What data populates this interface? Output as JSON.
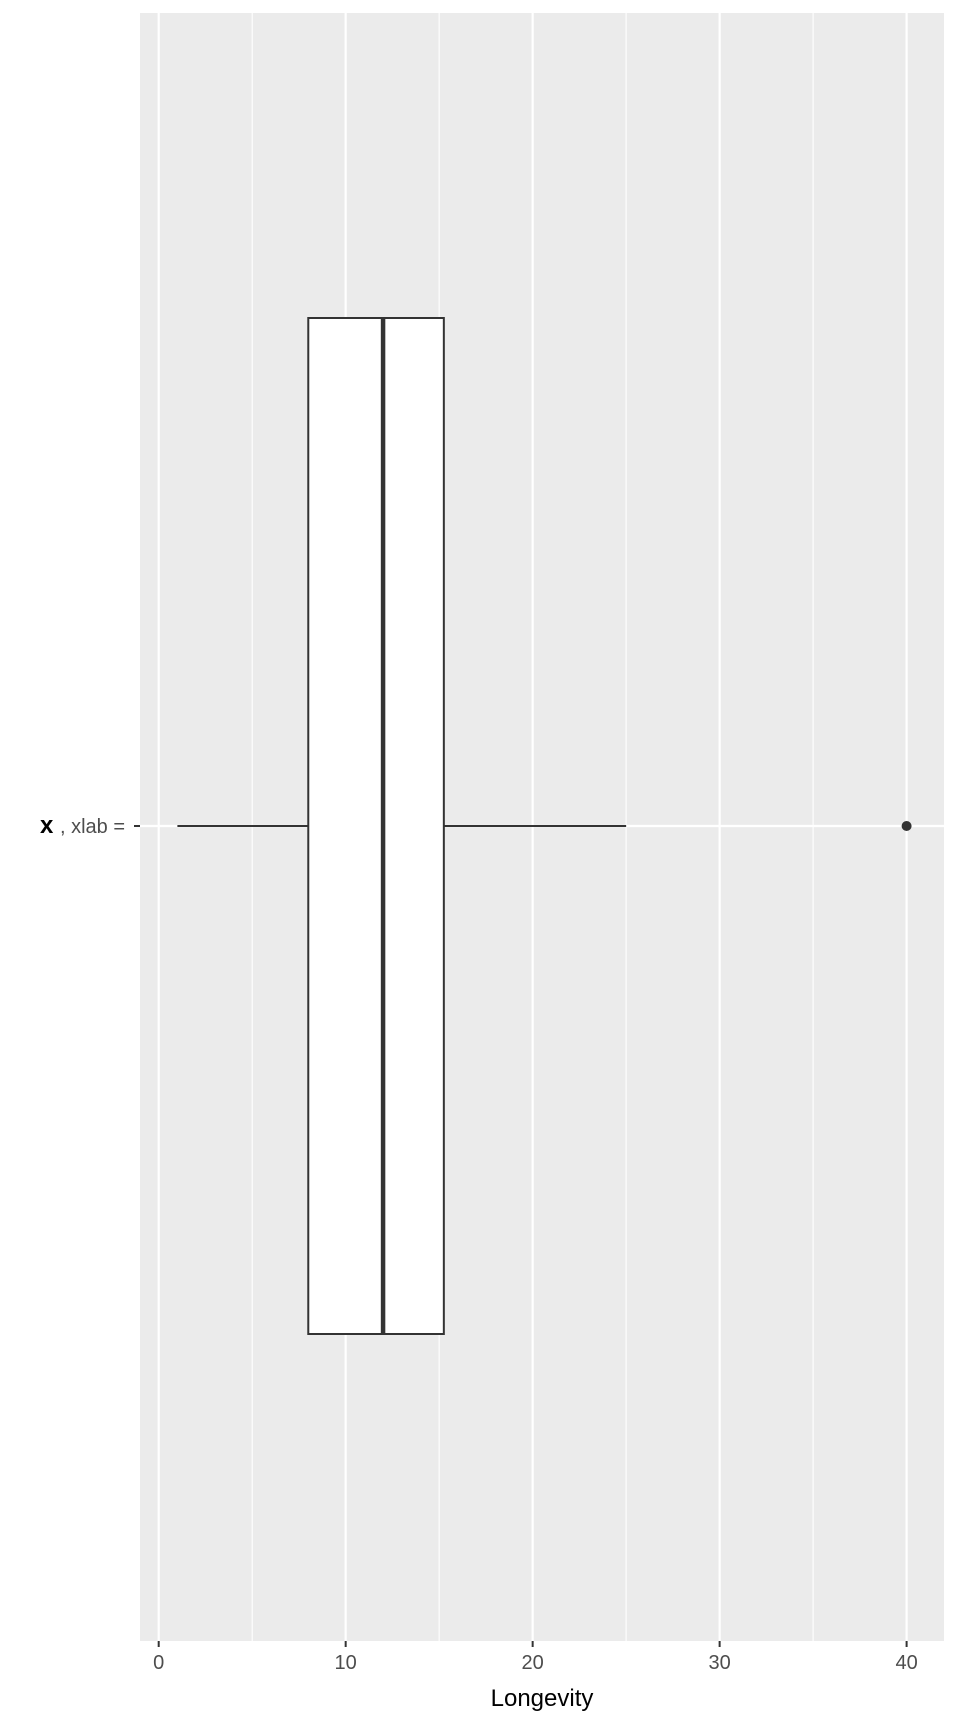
{
  "chart_data": {
    "type": "boxplot",
    "orientation": "horizontal",
    "xlabel": "Longevity",
    "ylabel": "",
    "xlim": [
      -1,
      42
    ],
    "x_ticks": [
      0,
      10,
      20,
      30,
      40
    ],
    "x_tick_labels": [
      "0",
      "10",
      "20",
      "30",
      "40"
    ],
    "y_categories": [
      {
        "label_bold": "x",
        "label_rest": ", xlab ="
      }
    ],
    "box": {
      "whisker_low": 1,
      "q1": 8,
      "median": 12,
      "q3": 15.25,
      "whisker_high": 25,
      "outliers": [
        40
      ]
    },
    "grid": true,
    "legend": "none",
    "colors": {
      "panel_background": "#EBEBEB",
      "grid_line": "#FFFFFF",
      "box_fill": "#FFFFFF",
      "box_stroke": "#333333",
      "whisker": "#333333",
      "outlier": "#333333",
      "tick_label": "#4D4D4D",
      "axis_title": "#000000"
    }
  }
}
